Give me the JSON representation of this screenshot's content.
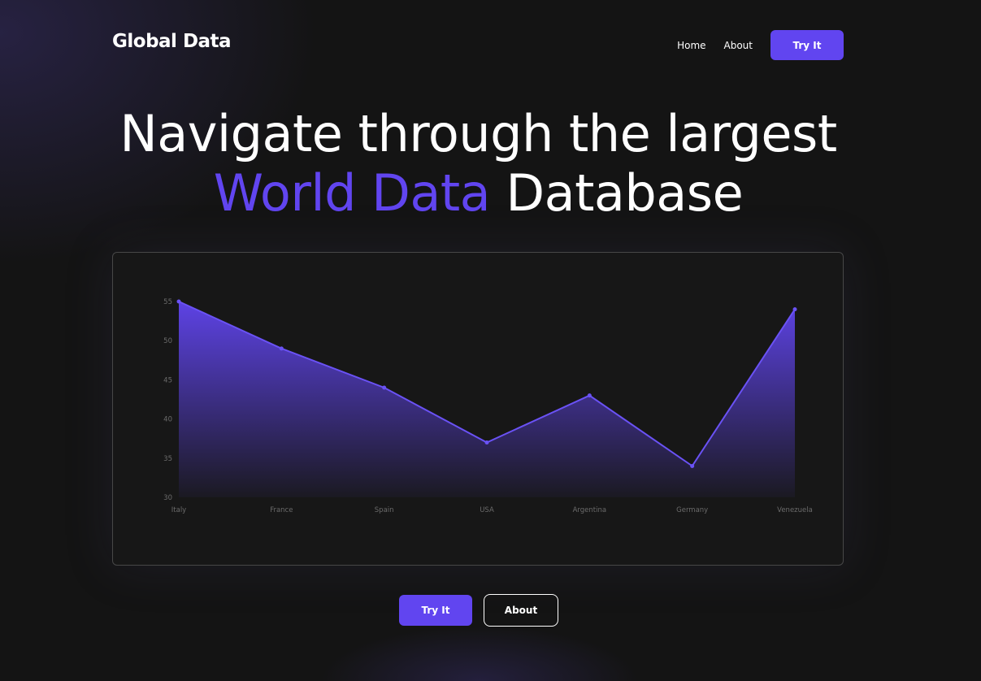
{
  "header": {
    "logo": "Global Data",
    "nav": {
      "home": "Home",
      "about": "About",
      "try_it": "Try It"
    }
  },
  "hero": {
    "line1": "Navigate through the largest",
    "accent": "World Data",
    "line2_rest": "Database"
  },
  "colors": {
    "accent": "#6145f0",
    "background": "#141414",
    "card_border": "#474747"
  },
  "chart_data": {
    "type": "area",
    "categories": [
      "Italy",
      "France",
      "Spain",
      "USA",
      "Argentina",
      "Germany",
      "Venezuela"
    ],
    "values": [
      55,
      49,
      44,
      37,
      43,
      34,
      54
    ],
    "ylim": [
      30,
      55
    ],
    "yticks": [
      30,
      35,
      40,
      45,
      50,
      55
    ],
    "grid": false,
    "title": "",
    "xlabel": "",
    "ylabel": ""
  },
  "cta": {
    "try_it": "Try It",
    "about": "About"
  }
}
